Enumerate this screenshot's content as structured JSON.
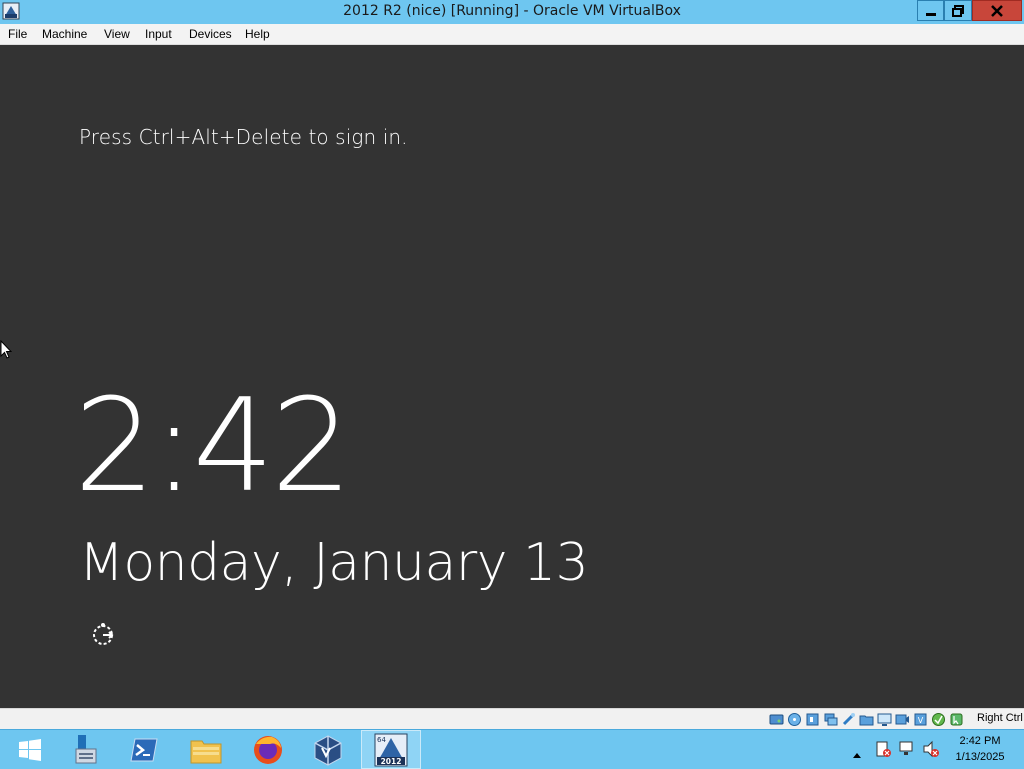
{
  "window": {
    "title": "2012 R2 (nice) [Running] - Oracle VM VirtualBox",
    "controls": {
      "minimize": "minimize",
      "maximize": "restore",
      "close": "close"
    }
  },
  "menu": [
    "File",
    "Machine",
    "View",
    "Input",
    "Devices",
    "Help"
  ],
  "guest": {
    "signin_prompt": "Press Ctrl+Alt+Delete to sign in.",
    "time": "2:42",
    "date": "Monday, January 13",
    "background_color": "#333333",
    "ease_of_access_icon": "ease-of-access-icon"
  },
  "statusbar": {
    "icons": [
      "hard-disk-icon",
      "optical-drive-icon",
      "audio-icon",
      "network-icon",
      "usb-icon",
      "shared-folders-icon",
      "display-icon",
      "recording-icon",
      "cpu-icon",
      "vt-x-icon",
      "mouse-integration-icon",
      "keyboard-icon"
    ],
    "host_key": "Right Ctrl"
  },
  "taskbar": {
    "items": [
      {
        "name": "start-button",
        "icon": "windows-logo-icon"
      },
      {
        "name": "server-manager",
        "icon": "server-manager-icon"
      },
      {
        "name": "powershell",
        "icon": "powershell-icon"
      },
      {
        "name": "file-explorer",
        "icon": "folder-icon"
      },
      {
        "name": "firefox",
        "icon": "firefox-icon"
      },
      {
        "name": "virtualbox",
        "icon": "virtualbox-icon"
      },
      {
        "name": "vm-2012",
        "icon": "windows-2012-icon",
        "badge": "64",
        "label": "2012"
      }
    ],
    "tray": {
      "clock_time": "2:42 PM",
      "clock_date": "1/13/2025"
    }
  }
}
